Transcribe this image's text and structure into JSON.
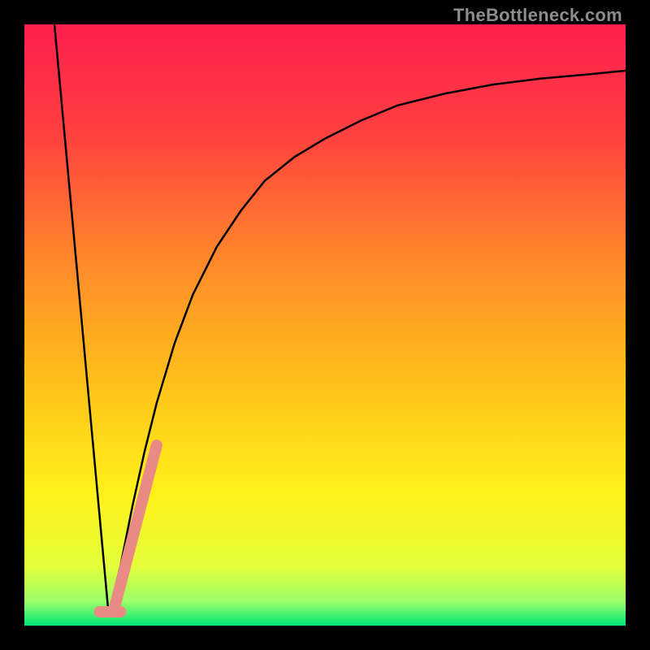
{
  "watermark": "TheBottleneck.com",
  "chart_data": {
    "type": "line",
    "title": "",
    "xlabel": "",
    "ylabel": "",
    "xlim": [
      0,
      100
    ],
    "ylim": [
      0,
      100
    ],
    "gradient_stops": [
      {
        "pos": 0.0,
        "color": "#ff1f4e"
      },
      {
        "pos": 0.18,
        "color": "#ff4040"
      },
      {
        "pos": 0.4,
        "color": "#ff8a2a"
      },
      {
        "pos": 0.6,
        "color": "#ffc21a"
      },
      {
        "pos": 0.78,
        "color": "#fff11a"
      },
      {
        "pos": 0.9,
        "color": "#e5ff3a"
      },
      {
        "pos": 0.96,
        "color": "#9bff6a"
      },
      {
        "pos": 1.0,
        "color": "#00e676"
      }
    ],
    "series": [
      {
        "name": "left-descent",
        "stroke": "#000000",
        "stroke_width": 2.5,
        "x": [
          5,
          14
        ],
        "values": [
          100,
          2
        ]
      },
      {
        "name": "right-curve",
        "stroke": "#000000",
        "stroke_width": 2.5,
        "x": [
          14,
          16,
          18,
          20,
          22,
          25,
          28,
          32,
          36,
          40,
          45,
          50,
          56,
          62,
          70,
          78,
          86,
          94,
          100
        ],
        "values": [
          2,
          10,
          20,
          29,
          37,
          47,
          55,
          63,
          69,
          74,
          78,
          81,
          84,
          86.5,
          88.5,
          90,
          91,
          91.7,
          92.3
        ]
      },
      {
        "name": "highlight-segment",
        "stroke": "#e98b84",
        "stroke_width": 14,
        "linecap": "round",
        "x": [
          15,
          22
        ],
        "values": [
          3,
          30
        ]
      },
      {
        "name": "highlight-bottom",
        "stroke": "#e98b84",
        "stroke_width": 14,
        "linecap": "round",
        "x": [
          12.5,
          16
        ],
        "values": [
          2.3,
          2.3
        ]
      }
    ]
  }
}
